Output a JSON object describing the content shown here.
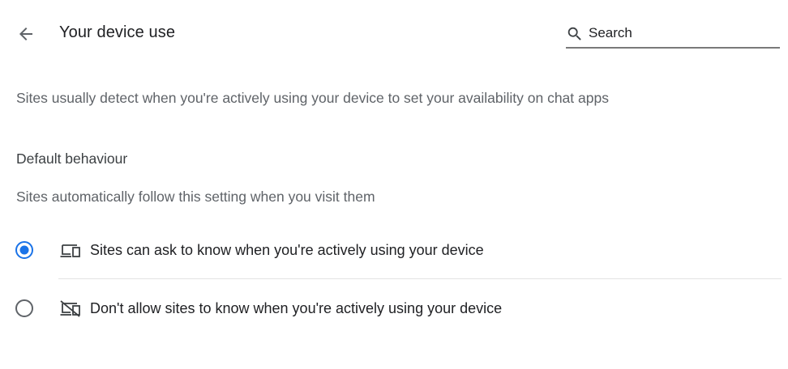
{
  "header": {
    "title": "Your device use",
    "search": {
      "placeholder": "Search"
    }
  },
  "description": "Sites usually detect when you're actively using your device to set your availability on chat apps",
  "default_behaviour": {
    "heading": "Default behaviour",
    "subtitle": "Sites automatically follow this setting when you visit them",
    "options": [
      {
        "label": "Sites can ask to know when you're actively using your device",
        "icon": "devices-icon",
        "selected": true
      },
      {
        "label": "Don't allow sites to know when you're actively using your device",
        "icon": "devices-off-icon",
        "selected": false
      }
    ]
  },
  "colors": {
    "accent": "#1a73e8",
    "radio_unselected": "#5f6368",
    "text_primary": "#202124",
    "text_secondary": "#5f6368"
  }
}
